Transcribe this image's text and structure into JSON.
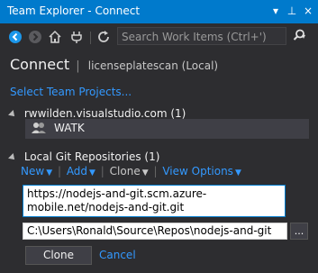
{
  "window": {
    "title": "Team Explorer - Connect",
    "controls": {
      "dropdown": "▾",
      "pin": "⊥",
      "close": "×"
    }
  },
  "toolbar": {
    "back_icon": "back-arrow",
    "forward_icon": "forward-arrow",
    "home_icon": "home",
    "connect_icon": "plug",
    "refresh_icon": "refresh",
    "search_placeholder": "Search Work Items (Ctrl+')",
    "search_button_icon": "search"
  },
  "header": {
    "title": "Connect",
    "separator": "|",
    "subtitle": "licenseplatescan (Local)"
  },
  "select_projects_link": "Select Team Projects...",
  "server": {
    "name": "rwwilden.visualstudio.com (1)",
    "items": [
      {
        "label": "WATK",
        "icon": "team-project"
      }
    ]
  },
  "local_git": {
    "title": "Local Git Repositories (1)",
    "actions": [
      {
        "label": "New",
        "has_menu": true
      },
      {
        "label": "Add",
        "has_menu": true
      },
      {
        "label": "Clone",
        "has_menu": true
      },
      {
        "label": "View Options",
        "has_menu": true
      }
    ],
    "clone_url": "https://nodejs-and-git.scm.azure-mobile.net/nodejs-and-git.git",
    "clone_path": "C:\\Users\\Ronald\\Source\\Repos\\nodejs-and-git",
    "browse_label": "...",
    "clone_button": "Clone",
    "cancel_link": "Cancel"
  },
  "colors": {
    "accent": "#007acc",
    "background": "#2d2d30",
    "link": "#3399ff",
    "selected_row": "#3f3f46"
  }
}
